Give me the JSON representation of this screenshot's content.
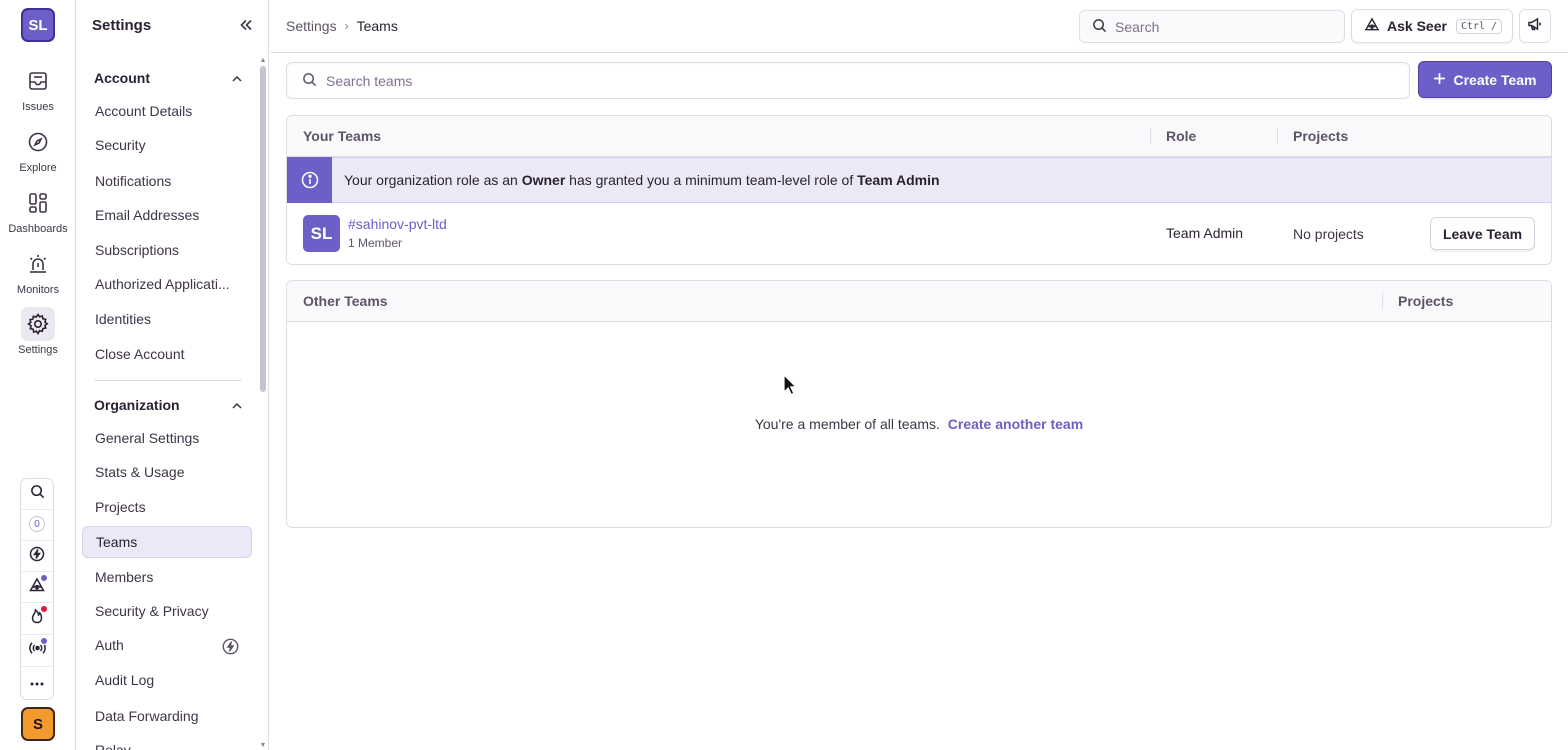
{
  "rail": {
    "org_initials": "SL",
    "items": [
      {
        "label": "Issues",
        "icon": "inbox-icon"
      },
      {
        "label": "Explore",
        "icon": "compass-icon"
      },
      {
        "label": "Dashboards",
        "icon": "dashboard-icon"
      },
      {
        "label": "Monitors",
        "icon": "siren-icon"
      },
      {
        "label": "Settings",
        "icon": "gear-icon"
      }
    ],
    "bottom": {
      "search_icon": "search-icon",
      "onboarding_count": "0",
      "quick_icons": [
        "bolt-icon",
        "seer-icon",
        "flame-icon",
        "broadcast-icon",
        "ellipsis-icon"
      ],
      "dot_colors": {
        "seer": "#6c5fc7",
        "flame": "#e1173b",
        "broadcast": "#6c5fc7"
      }
    },
    "user_initial": "S"
  },
  "sidebar": {
    "title": "Settings",
    "account": {
      "heading": "Account",
      "items": [
        "Account Details",
        "Security",
        "Notifications",
        "Email Addresses",
        "Subscriptions",
        "Authorized Applicati...",
        "Identities",
        "Close Account"
      ]
    },
    "organization": {
      "heading": "Organization",
      "items": [
        "General Settings",
        "Stats & Usage",
        "Projects",
        "Teams",
        "Members",
        "Security & Privacy",
        "Auth",
        "Audit Log",
        "Data Forwarding",
        "Relay"
      ],
      "active": "Teams"
    }
  },
  "topbar": {
    "breadcrumb_root": "Settings",
    "breadcrumb_separator": "›",
    "breadcrumb_current": "Teams",
    "search_placeholder": "Search",
    "ask_seer_label": "Ask Seer",
    "ask_seer_shortcut": "Ctrl /"
  },
  "main": {
    "search_placeholder": "Search teams",
    "create_team_label": "Create Team",
    "your_teams": {
      "header": "Your Teams",
      "col_role": "Role",
      "col_projects": "Projects",
      "alert": {
        "prefix": "Your organization role as an ",
        "role": "Owner",
        "middle": " has granted you a minimum team-level role of ",
        "team_role": "Team Admin"
      },
      "teams": [
        {
          "initials": "SL",
          "name": "#sahinov-pvt-ltd",
          "members": "1 Member",
          "role": "Team Admin",
          "projects": "No projects",
          "action": "Leave Team"
        }
      ]
    },
    "other_teams": {
      "header": "Other Teams",
      "col_projects": "Projects",
      "empty_text": "You're a member of all teams.",
      "empty_link": "Create another team"
    }
  },
  "colors": {
    "accent": "#6c5fc7",
    "alert_bg": "#ebe8f8",
    "user_avatar": "#f29a2e"
  }
}
